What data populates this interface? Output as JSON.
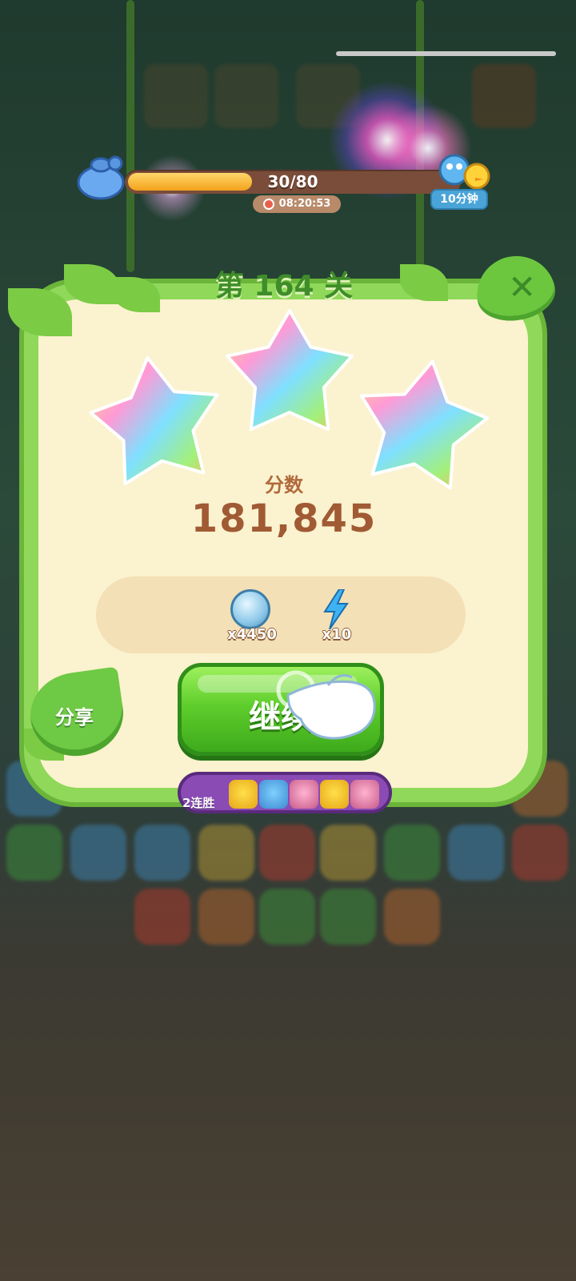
{
  "progress": {
    "value": 30,
    "max": 80,
    "text": "30/80",
    "timer": "08:20:53",
    "reward_badge": "10分钟"
  },
  "panel": {
    "title": "第 164 关",
    "stars_earned": 3,
    "score_label": "分数",
    "score_value": "181,845",
    "rewards": [
      {
        "icon": "leaf-coin-icon",
        "count": "x4450"
      },
      {
        "icon": "lightning-icon",
        "count": "x10"
      }
    ],
    "continue_label": "继续",
    "share_label": "分享",
    "close_icon": "close-icon"
  },
  "streak": {
    "label": "2连胜",
    "icons": [
      "chick-icon",
      "blue-bird-icon",
      "peacock-icon",
      "chick-icon",
      "peacock-icon"
    ]
  },
  "colors": {
    "panel_green": "#8fd85a",
    "panel_cream": "#fbf2cf",
    "score_brown": "#a05a34",
    "button_green": "#5fce2c",
    "streak_purple": "#8a4bb5"
  }
}
